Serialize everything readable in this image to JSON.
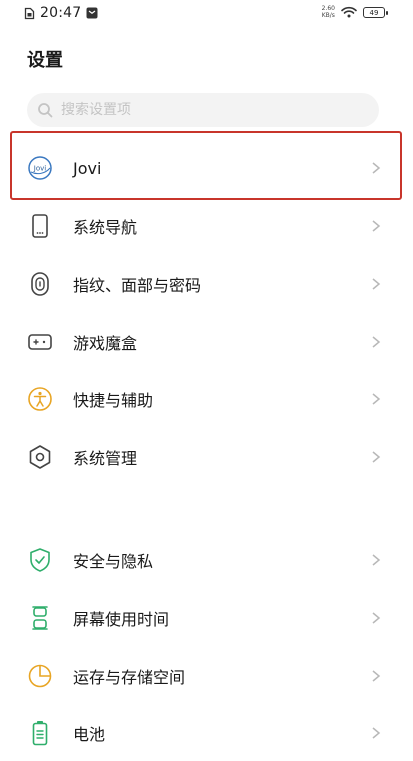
{
  "status_bar": {
    "time": "20:47",
    "net_speed_value": "2.60",
    "net_speed_unit": "KB/s",
    "battery_level": "49"
  },
  "page_title": "设置",
  "search": {
    "placeholder": "搜索设置项"
  },
  "jovi_logo_text": "Jovi",
  "items": [
    {
      "label": "Jovi",
      "icon": "jovi-logo-icon"
    },
    {
      "label": "系统导航",
      "icon": "phone-icon"
    },
    {
      "label": "指纹、面部与密码",
      "icon": "fingerprint-icon"
    },
    {
      "label": "游戏魔盒",
      "icon": "game-box-icon"
    },
    {
      "label": "快捷与辅助",
      "icon": "accessibility-icon"
    },
    {
      "label": "系统管理",
      "icon": "hexagon-settings-icon"
    },
    {
      "label": "安全与隐私",
      "icon": "shield-check-icon"
    },
    {
      "label": "屏幕使用时间",
      "icon": "hourglass-icon"
    },
    {
      "label": "运存与存储空间",
      "icon": "pie-chart-icon"
    },
    {
      "label": "电池",
      "icon": "battery-icon"
    }
  ],
  "colors": {
    "highlight_border": "#c8352b",
    "icon_stroke": "#444444",
    "accessibility_icon": "#e8a524",
    "security_icon": "#2fae6b",
    "pie_icon": "#e8a524",
    "battery_icon": "#2fae6b",
    "jovi_icon": "#3a78c0"
  }
}
